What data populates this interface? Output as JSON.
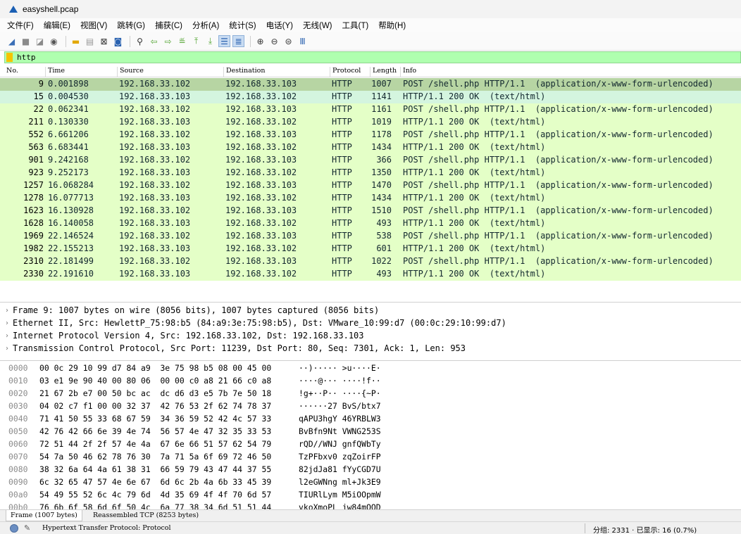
{
  "window": {
    "title": "easyshell.pcap"
  },
  "menu": [
    "文件(F)",
    "编辑(E)",
    "视图(V)",
    "跳转(G)",
    "捕获(C)",
    "分析(A)",
    "统计(S)",
    "电话(Y)",
    "无线(W)",
    "工具(T)",
    "帮助(H)"
  ],
  "toolbar": {
    "icons": [
      "shark-fin-start-icon",
      "stop-capture-icon",
      "restart-capture-icon",
      "capture-options-icon",
      "open-file-icon",
      "save-file-icon",
      "close-file-icon",
      "reload-file-icon",
      "find-packet-icon",
      "go-back-icon",
      "go-forward-icon",
      "go-to-packet-icon",
      "go-first-icon",
      "go-last-icon",
      "auto-scroll-icon",
      "colorize-icon",
      "zoom-in-icon",
      "zoom-out-icon",
      "zoom-normal-icon",
      "resize-columns-icon"
    ]
  },
  "filter": {
    "value": "http"
  },
  "packet_list": {
    "columns": [
      "No.",
      "Time",
      "Source",
      "Destination",
      "Protocol",
      "Length",
      "Info"
    ],
    "rows": [
      {
        "no": "9",
        "time": "0.001898",
        "src": "192.168.33.102",
        "dst": "192.168.33.103",
        "proto": "HTTP",
        "len": "1007",
        "info": "POST /shell.php HTTP/1.1  (application/x-www-form-urlencoded)"
      },
      {
        "no": "15",
        "time": "0.004530",
        "src": "192.168.33.103",
        "dst": "192.168.33.102",
        "proto": "HTTP",
        "len": "1141",
        "info": "HTTP/1.1 200 OK  (text/html)"
      },
      {
        "no": "22",
        "time": "0.062341",
        "src": "192.168.33.102",
        "dst": "192.168.33.103",
        "proto": "HTTP",
        "len": "1161",
        "info": "POST /shell.php HTTP/1.1  (application/x-www-form-urlencoded)"
      },
      {
        "no": "211",
        "time": "0.130330",
        "src": "192.168.33.103",
        "dst": "192.168.33.102",
        "proto": "HTTP",
        "len": "1019",
        "info": "HTTP/1.1 200 OK  (text/html)"
      },
      {
        "no": "552",
        "time": "6.661206",
        "src": "192.168.33.102",
        "dst": "192.168.33.103",
        "proto": "HTTP",
        "len": "1178",
        "info": "POST /shell.php HTTP/1.1  (application/x-www-form-urlencoded)"
      },
      {
        "no": "563",
        "time": "6.683441",
        "src": "192.168.33.103",
        "dst": "192.168.33.102",
        "proto": "HTTP",
        "len": "1434",
        "info": "HTTP/1.1 200 OK  (text/html)"
      },
      {
        "no": "901",
        "time": "9.242168",
        "src": "192.168.33.102",
        "dst": "192.168.33.103",
        "proto": "HTTP",
        "len": "366",
        "info": "POST /shell.php HTTP/1.1  (application/x-www-form-urlencoded)"
      },
      {
        "no": "923",
        "time": "9.252173",
        "src": "192.168.33.103",
        "dst": "192.168.33.102",
        "proto": "HTTP",
        "len": "1350",
        "info": "HTTP/1.1 200 OK  (text/html)"
      },
      {
        "no": "1257",
        "time": "16.068284",
        "src": "192.168.33.102",
        "dst": "192.168.33.103",
        "proto": "HTTP",
        "len": "1470",
        "info": "POST /shell.php HTTP/1.1  (application/x-www-form-urlencoded)"
      },
      {
        "no": "1278",
        "time": "16.077713",
        "src": "192.168.33.103",
        "dst": "192.168.33.102",
        "proto": "HTTP",
        "len": "1434",
        "info": "HTTP/1.1 200 OK  (text/html)"
      },
      {
        "no": "1623",
        "time": "16.130928",
        "src": "192.168.33.102",
        "dst": "192.168.33.103",
        "proto": "HTTP",
        "len": "1510",
        "info": "POST /shell.php HTTP/1.1  (application/x-www-form-urlencoded)"
      },
      {
        "no": "1628",
        "time": "16.140058",
        "src": "192.168.33.103",
        "dst": "192.168.33.102",
        "proto": "HTTP",
        "len": "493",
        "info": "HTTP/1.1 200 OK  (text/html)"
      },
      {
        "no": "1969",
        "time": "22.146524",
        "src": "192.168.33.102",
        "dst": "192.168.33.103",
        "proto": "HTTP",
        "len": "538",
        "info": "POST /shell.php HTTP/1.1  (application/x-www-form-urlencoded)"
      },
      {
        "no": "1982",
        "time": "22.155213",
        "src": "192.168.33.103",
        "dst": "192.168.33.102",
        "proto": "HTTP",
        "len": "601",
        "info": "HTTP/1.1 200 OK  (text/html)"
      },
      {
        "no": "2310",
        "time": "22.181499",
        "src": "192.168.33.102",
        "dst": "192.168.33.103",
        "proto": "HTTP",
        "len": "1022",
        "info": "POST /shell.php HTTP/1.1  (application/x-www-form-urlencoded)"
      },
      {
        "no": "2330",
        "time": "22.191610",
        "src": "192.168.33.103",
        "dst": "192.168.33.102",
        "proto": "HTTP",
        "len": "493",
        "info": "HTTP/1.1 200 OK  (text/html)"
      }
    ]
  },
  "details": [
    "Frame 9: 1007 bytes on wire (8056 bits), 1007 bytes captured (8056 bits)",
    "Ethernet II, Src: HewlettP_75:98:b5 (84:a9:3e:75:98:b5), Dst: VMware_10:99:d7 (00:0c:29:10:99:d7)",
    "Internet Protocol Version 4, Src: 192.168.33.102, Dst: 192.168.33.103",
    "Transmission Control Protocol, Src Port: 11239, Dst Port: 80, Seq: 7301, Ack: 1, Len: 953"
  ],
  "bytes": [
    {
      "off": "0000",
      "hex": "00 0c 29 10 99 d7 84 a9  3e 75 98 b5 08 00 45 00",
      "ascii": "··)····· >u····E·"
    },
    {
      "off": "0010",
      "hex": "03 e1 9e 90 40 00 80 06  00 00 c0 a8 21 66 c0 a8",
      "ascii": "····@··· ····!f··"
    },
    {
      "off": "0020",
      "hex": "21 67 2b e7 00 50 bc ac  dc d6 d3 e5 7b 7e 50 18",
      "ascii": "!g+··P·· ····{~P·"
    },
    {
      "off": "0030",
      "hex": "04 02 c7 f1 00 00 32 37  42 76 53 2f 62 74 78 37",
      "ascii": "······27 BvS/btx7"
    },
    {
      "off": "0040",
      "hex": "71 41 50 55 33 68 67 59  34 36 59 52 42 4c 57 33",
      "ascii": "qAPU3hgY 46YRBLW3"
    },
    {
      "off": "0050",
      "hex": "42 76 42 66 6e 39 4e 74  56 57 4e 47 32 35 33 53",
      "ascii": "BvBfn9Nt VWNG253S"
    },
    {
      "off": "0060",
      "hex": "72 51 44 2f 2f 57 4e 4a  67 6e 66 51 57 62 54 79",
      "ascii": "rQD//WNJ gnfQWbTy"
    },
    {
      "off": "0070",
      "hex": "54 7a 50 46 62 78 76 30  7a 71 5a 6f 69 72 46 50",
      "ascii": "TzPFbxv0 zqZoirFP"
    },
    {
      "off": "0080",
      "hex": "38 32 6a 64 4a 61 38 31  66 59 79 43 47 44 37 55",
      "ascii": "82jdJa81 fYyCGD7U"
    },
    {
      "off": "0090",
      "hex": "6c 32 65 47 57 4e 6e 67  6d 6c 2b 4a 6b 33 45 39",
      "ascii": "l2eGWNng ml+Jk3E9"
    },
    {
      "off": "00a0",
      "hex": "54 49 55 52 6c 4c 79 6d  4d 35 69 4f 4f 70 6d 57",
      "ascii": "TIURlLym M5iOOpmW"
    },
    {
      "off": "00b0",
      "hex": "76 6b 6f 58 6d 6f 50 4c  6a 77 38 34 6d 51 51 44",
      "ascii": "vkoXmoPL jw84mQQD"
    }
  ],
  "byte_tabs": [
    "Frame (1007 bytes)",
    "Reassembled TCP (8253 bytes)"
  ],
  "status": {
    "left": "Hypertext Transfer Protocol: Protocol",
    "right": "分组: 2331 · 已显示: 16 (0.7%)"
  },
  "colors": {
    "http_row": "#e4ffc7",
    "selected_row": "#b7d5a3",
    "related_row": "#d4f5df",
    "filter_bg": "#afffaf",
    "protocol_text": "#12272e"
  }
}
